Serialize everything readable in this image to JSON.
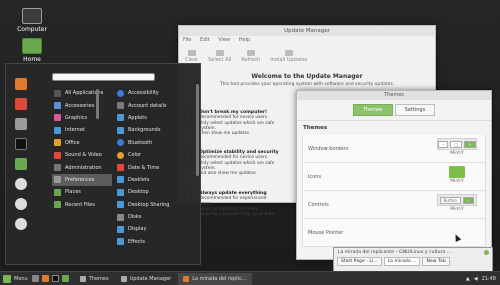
{
  "desktop": {
    "icons": [
      {
        "label": "Computer"
      },
      {
        "label": "Home"
      }
    ]
  },
  "update_manager": {
    "title": "Update Manager",
    "menu": [
      "File",
      "Edit",
      "View",
      "Help"
    ],
    "toolbar": [
      "Clear",
      "Select All",
      "Refresh",
      "Install Updates"
    ],
    "welcome_title": "Welcome to the Update Manager",
    "welcome_sub": "This tool provides your operating system with software and security updates.",
    "sections": [
      {
        "title": "Don't break my computer!",
        "lines": [
          "Recommended for novice users.",
          "Only select updates which are safe",
          "system.",
          "Then show me updates"
        ]
      },
      {
        "title": "Optimize stability and security",
        "lines": [
          "Recommended for novice users.",
          "Only select updates which are safe",
          "system.",
          "But also show me updates"
        ]
      },
      {
        "title": "Always update everything",
        "lines": [
          "Recommended for experienced users.",
          "Select all updates and keep",
          "Keep my computer fully up-to-date"
        ]
      }
    ]
  },
  "themes": {
    "title": "Themes",
    "tabs": [
      "Themes",
      "Settings"
    ],
    "heading": "Themes",
    "rows": [
      {
        "label": "Window borders",
        "preview": "Mint-Y"
      },
      {
        "label": "Icons",
        "preview": "Mint-Y"
      },
      {
        "label": "Controls",
        "preview": "Mint-Y",
        "button": "Button"
      },
      {
        "label": "Mouse Pointer",
        "preview": ""
      }
    ]
  },
  "menu": {
    "search_placeholder": "",
    "categories": [
      "All Applications",
      "Accessories",
      "Graphics",
      "Internet",
      "Office",
      "Sound & Video",
      "Administration",
      "Preferences",
      "Places",
      "Recent Files"
    ],
    "apps": [
      "Accessibility",
      "Account details",
      "Applets",
      "Backgrounds",
      "Bluetooth",
      "Color",
      "Date & Time",
      "Desklets",
      "Desktop",
      "Desktop Sharing",
      "Disks",
      "Display",
      "Effects"
    ]
  },
  "taskbar": {
    "menu_label": "Menu",
    "tasks": [
      "Themes",
      "Update Manager",
      "La mirada del replic..."
    ],
    "clock": "21:48"
  },
  "firefox_preview": {
    "title": "La mirada del replicante – GNU/Linux y cultura ...",
    "tabs": [
      "Start Page - Li...",
      "La mirada ...",
      "New Tab"
    ]
  }
}
